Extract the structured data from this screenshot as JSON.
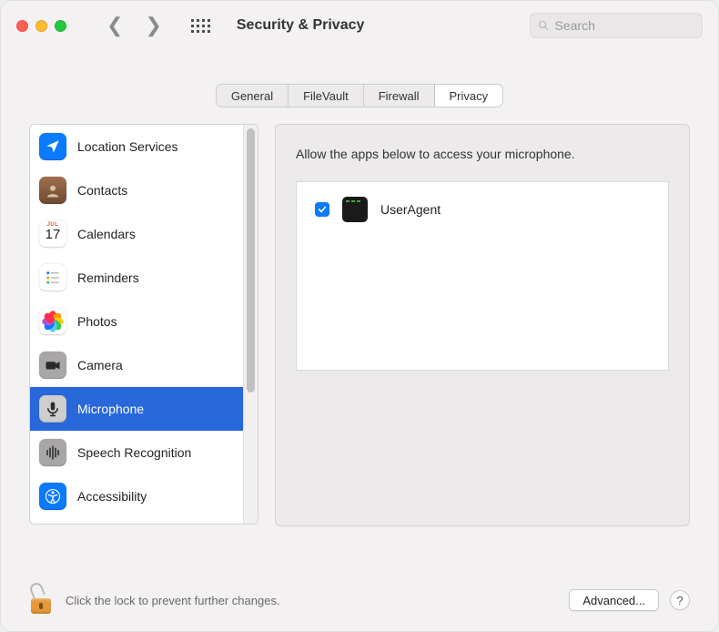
{
  "window": {
    "title": "Security & Privacy"
  },
  "search": {
    "placeholder": "Search"
  },
  "tabs": [
    {
      "id": "general",
      "label": "General",
      "active": false
    },
    {
      "id": "filevault",
      "label": "FileVault",
      "active": false
    },
    {
      "id": "firewall",
      "label": "Firewall",
      "active": false
    },
    {
      "id": "privacy",
      "label": "Privacy",
      "active": true
    }
  ],
  "sidebar": {
    "items": [
      {
        "id": "location-services",
        "label": "Location Services",
        "icon": "location-arrow",
        "bg": "#0a7aff",
        "fg": "#fff"
      },
      {
        "id": "contacts",
        "label": "Contacts",
        "icon": "contact-card",
        "bg": "#8a5a3c",
        "fg": "#fff"
      },
      {
        "id": "calendars",
        "label": "Calendars",
        "icon": "calendar",
        "month": "JUL",
        "day": "17"
      },
      {
        "id": "reminders",
        "label": "Reminders",
        "icon": "list-bullets",
        "bg": "#fff",
        "fg": "#333"
      },
      {
        "id": "photos",
        "label": "Photos",
        "icon": "photos-flower",
        "bg": "#fff"
      },
      {
        "id": "camera",
        "label": "Camera",
        "icon": "camera",
        "bg": "#a5a3a4",
        "fg": "#2a2a2a"
      },
      {
        "id": "microphone",
        "label": "Microphone",
        "icon": "microphone",
        "bg": "#a5a3a4",
        "fg": "#2a2a2a",
        "selected": true
      },
      {
        "id": "speech-recognition",
        "label": "Speech Recognition",
        "icon": "waveform",
        "bg": "#a5a3a4",
        "fg": "#2a2a2a"
      },
      {
        "id": "accessibility",
        "label": "Accessibility",
        "icon": "accessibility",
        "bg": "#0a7aff",
        "fg": "#fff"
      }
    ]
  },
  "main": {
    "description": "Allow the apps below to access your microphone.",
    "apps": [
      {
        "name": "UserAgent",
        "checked": true
      }
    ]
  },
  "footer": {
    "lock_text": "Click the lock to prevent further changes.",
    "advanced_label": "Advanced...",
    "help_label": "?"
  }
}
